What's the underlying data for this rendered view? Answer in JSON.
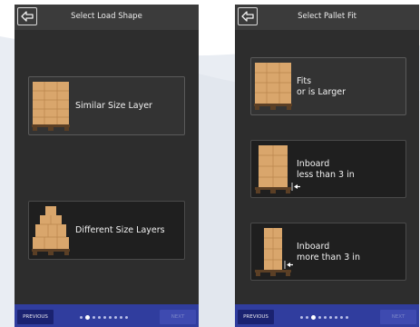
{
  "left_screen": {
    "title": "Select Load Shape",
    "options": [
      {
        "label": "Similar Size Layer",
        "icon": "uniform-layers-pallet-icon",
        "selected": true
      },
      {
        "label": "Different Size Layers",
        "icon": "mixed-layers-pallet-icon",
        "selected": false
      }
    ],
    "footer": {
      "previous_label": "PREVIOUS",
      "next_label": "NEXT",
      "page_count": 9,
      "current_page": 1
    }
  },
  "right_screen": {
    "title": "Select Pallet Fit",
    "options": [
      {
        "label": "Fits\nor is Larger",
        "icon": "fits-pallet-icon",
        "selected": true
      },
      {
        "label": "Inboard\nless than 3 in",
        "icon": "inboard-small-pallet-icon",
        "selected": false
      },
      {
        "label": "Inboard\nmore than 3 in",
        "icon": "inboard-large-pallet-icon",
        "selected": false
      }
    ],
    "footer": {
      "previous_label": "PREVIOUS",
      "next_label": "NEXT",
      "page_count": 9,
      "current_page": 2
    }
  },
  "colors": {
    "screen_bg": "#2d2d2d",
    "topbar": "#3b3b3b",
    "footer": "#303d9e",
    "box": "#d9a66c",
    "pallet": "#5b3f25"
  }
}
